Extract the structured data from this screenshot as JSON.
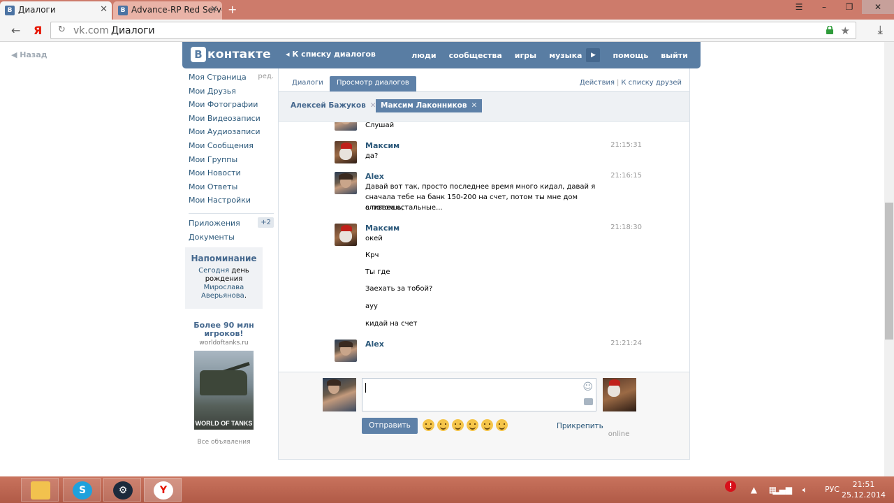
{
  "browser": {
    "tabs": [
      {
        "label": "Диалоги",
        "icon": "vk-icon"
      },
      {
        "label": "Advance-RP Red Server",
        "icon": "vk-icon"
      }
    ],
    "new_tab": "+",
    "url_domain": "vk.com",
    "url_title": "Диалоги",
    "win_controls": {
      "menu": "☰",
      "minimize": "–",
      "maximize": "❐",
      "close": "✕"
    }
  },
  "page": {
    "back_link": "Назад",
    "header": {
      "logo_letter": "В",
      "logo_text": "контакте",
      "back_to_dialogs": "К списку диалогов",
      "nav": [
        "люди",
        "сообщества",
        "игры",
        "музыка",
        "помощь",
        "выйти"
      ]
    },
    "sidebar": {
      "items": [
        {
          "label": "Моя Страница",
          "extra": "ред."
        },
        {
          "label": "Мои Друзья"
        },
        {
          "label": "Мои Фотографии"
        },
        {
          "label": "Мои Видеозаписи"
        },
        {
          "label": "Мои Аудиозаписи"
        },
        {
          "label": "Мои Сообщения"
        },
        {
          "label": "Мои Группы"
        },
        {
          "label": "Мои Новости"
        },
        {
          "label": "Мои Ответы"
        },
        {
          "label": "Мои Настройки"
        }
      ],
      "apps_label": "Приложения",
      "apps_badge": "+2",
      "docs_label": "Документы"
    },
    "reminder": {
      "title": "Напоминание",
      "today": "Сегодня",
      "bday": "день рождения",
      "person": "Мирослава Аверьянова",
      "dot": "."
    },
    "ad": {
      "title": "Более 90 млн игроков!",
      "domain": "worldoftanks.ru",
      "logo_text": "WORLD OF TANKS",
      "all_ads": "Все объявления"
    },
    "dialog": {
      "tabs": [
        "Диалоги",
        "Просмотр диалогов"
      ],
      "actions": "Действия",
      "to_friends": "К списку друзей",
      "chips": [
        "Алексей Бажуков",
        "Максим Лаконников"
      ],
      "messages": [
        {
          "author": "",
          "time": "",
          "lines": [
            "Слушай"
          ],
          "avatar": "alex"
        },
        {
          "author": "Максим",
          "time": "21:15:31",
          "lines": [
            "да?"
          ],
          "avatar": "max"
        },
        {
          "author": "Alex",
          "time": "21:16:15",
          "lines": [
            "Давай вот так, просто последнее время много кидал, давай я",
            "сначала тебе на банк 150-200 на счет, потом ты мне дом сливаешь,",
            "а потом остальные..."
          ],
          "avatar": "alex"
        },
        {
          "author": "Максим",
          "time": "21:18:30",
          "lines": [
            "окей",
            "Крч",
            "Ты где",
            "Заехать за тобой?",
            "ayy",
            "кидай на счет"
          ],
          "avatar": "max"
        },
        {
          "author": "Alex",
          "time": "21:21:24",
          "lines": [],
          "avatar": "alex"
        }
      ],
      "compose": {
        "send": "Отправить",
        "attach": "Прикрепить",
        "online": "online"
      }
    }
  },
  "taskbar": {
    "apps": [
      "folder-icon",
      "skype-icon",
      "steam-icon",
      "yandex-browser-icon"
    ],
    "lang": "РУС",
    "time": "21:51",
    "date": "25.12.2014"
  }
}
